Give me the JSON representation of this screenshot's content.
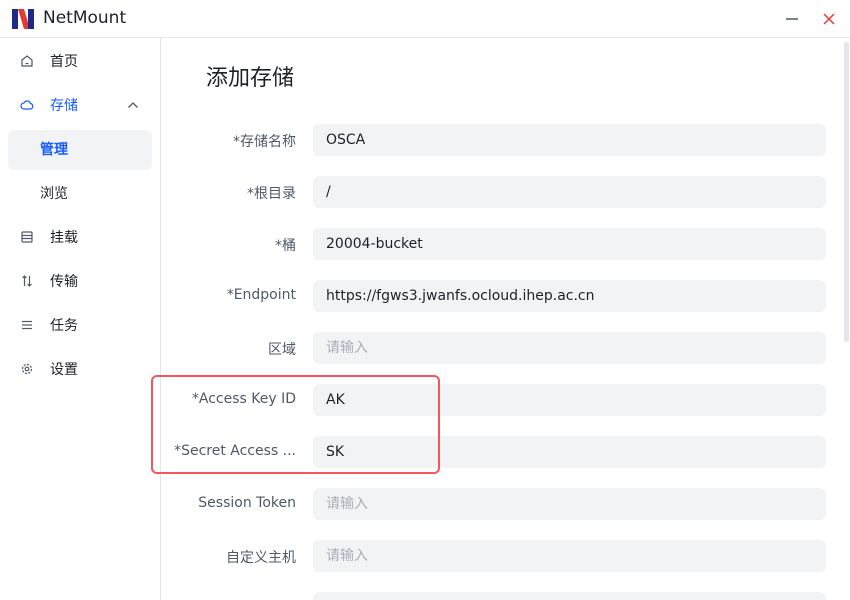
{
  "app": {
    "title": "NetMount"
  },
  "sidebar": {
    "items": [
      {
        "label": "首页",
        "icon": "home-icon"
      },
      {
        "label": "存储",
        "icon": "cloud-icon"
      },
      {
        "label": "管理"
      },
      {
        "label": "浏览"
      },
      {
        "label": "挂载",
        "icon": "drive-icon"
      },
      {
        "label": "传输",
        "icon": "transfer-icon"
      },
      {
        "label": "任务",
        "icon": "list-icon"
      },
      {
        "label": "设置",
        "icon": "gear-icon"
      }
    ]
  },
  "page": {
    "title": "添加存储"
  },
  "form": {
    "storage_name": {
      "label": "*存储名称",
      "value": "OSCA",
      "placeholder": ""
    },
    "root_dir": {
      "label": "*根目录",
      "value": "/",
      "placeholder": ""
    },
    "bucket": {
      "label": "*桶",
      "value": "20004-bucket",
      "placeholder": ""
    },
    "endpoint": {
      "label": "*Endpoint",
      "value": "https://fgws3.jwanfs.ocloud.ihep.ac.cn",
      "placeholder": ""
    },
    "region": {
      "label": "区域",
      "value": "",
      "placeholder": "请输入"
    },
    "access_key_id": {
      "label": "*Access Key ID",
      "value": "AK",
      "placeholder": ""
    },
    "secret_access_key": {
      "label": "*Secret Access ...",
      "value": "SK",
      "placeholder": ""
    },
    "session_token": {
      "label": "Session Token",
      "value": "",
      "placeholder": "请输入"
    },
    "custom_host": {
      "label": "自定义主机",
      "value": "",
      "placeholder": "请输入"
    }
  },
  "colors": {
    "accent": "#165dff",
    "highlight": "#f0575e",
    "input_bg": "#f2f3f5"
  }
}
